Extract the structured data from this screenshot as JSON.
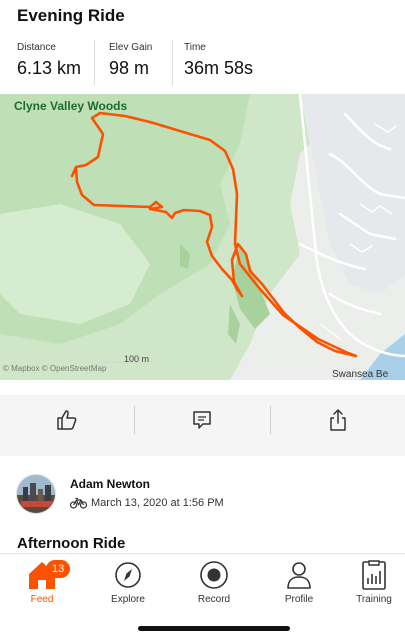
{
  "activity": {
    "title": "Evening Ride",
    "stats": [
      {
        "label": "Distance",
        "value": "6.13 km"
      },
      {
        "label": "Elev Gain",
        "value": "98 m"
      },
      {
        "label": "Time",
        "value": "36m 58s"
      }
    ]
  },
  "map": {
    "area_label": "Clyne Valley Woods",
    "scale_label": "100 m",
    "attribution": "© Mapbox © OpenStreetMap",
    "place_label": "Swansea Be",
    "route_color": "#fc5200"
  },
  "actions": {
    "kudos_icon": "thumbs-up-icon",
    "comment_icon": "comment-icon",
    "share_icon": "share-icon"
  },
  "next_post": {
    "author": "Adam Newton",
    "date": "March 13, 2020 at 1:56 PM",
    "activity_icon": "bike-icon",
    "title": "Afternoon Ride"
  },
  "tabbar": {
    "feed": {
      "label": "Feed",
      "badge": "13"
    },
    "explore": {
      "label": "Explore"
    },
    "record": {
      "label": "Record"
    },
    "profile": {
      "label": "Profile"
    },
    "training": {
      "label": "Training"
    }
  },
  "colors": {
    "accent": "#fc5200",
    "map_green": "#c6e3bf"
  }
}
